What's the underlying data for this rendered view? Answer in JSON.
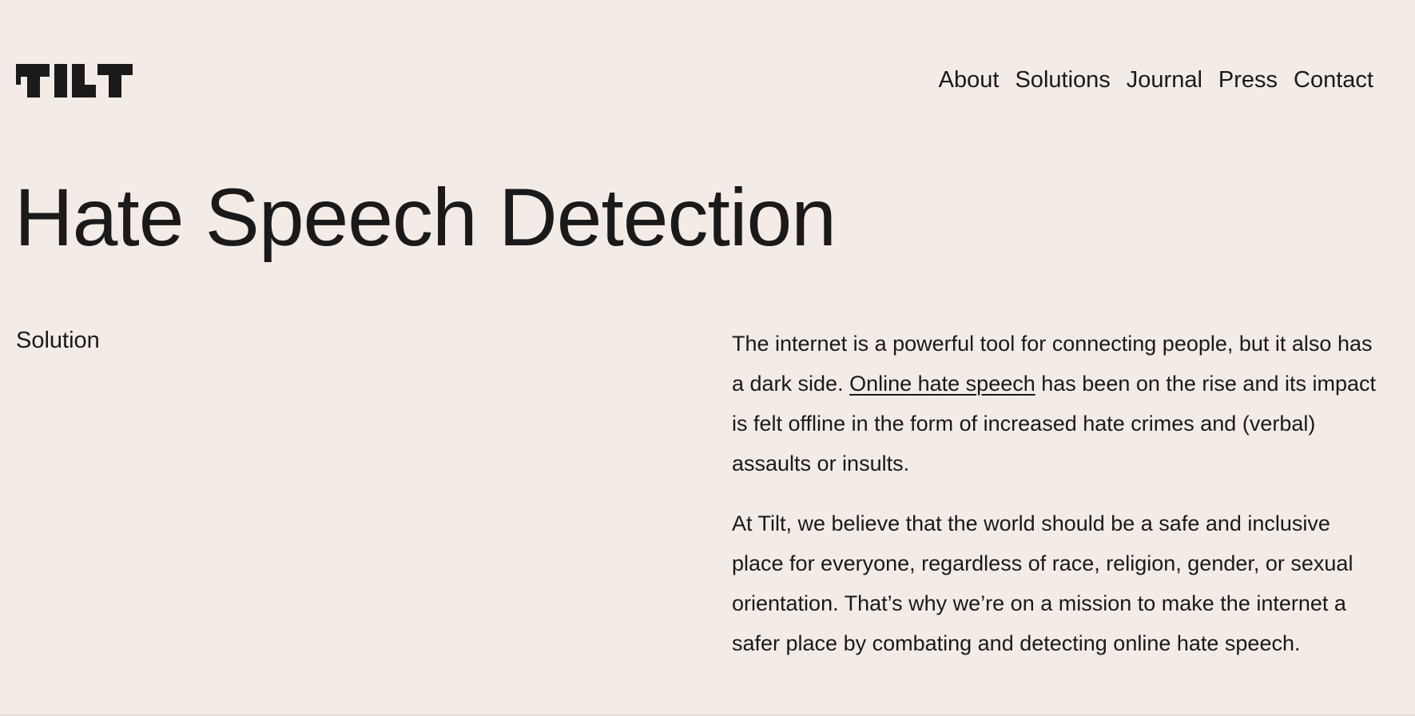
{
  "brand": {
    "logo_text": "TILT",
    "icon": "tilt-wordmark-logo"
  },
  "nav": {
    "items": [
      {
        "label": "About"
      },
      {
        "label": "Solutions"
      },
      {
        "label": "Journal"
      },
      {
        "label": "Press"
      },
      {
        "label": "Contact"
      }
    ]
  },
  "hero": {
    "title": "Hate Speech Detection"
  },
  "section": {
    "label": "Solution"
  },
  "content": {
    "p1_before_link": "The internet is a powerful tool for connecting people, but it also has a dark side. ",
    "p1_link": "Online hate speech",
    "p1_after_link": " has been on the rise and its impact is felt offline in the form of increased hate crimes and (verbal) assaults or insults.",
    "p2": "At Tilt, we believe that the world should be a safe and inclusive place for everyone, regardless of race, religion, gender, or sexual orientation. That’s why we’re on a mission to make the internet a safer place by combating and detecting online hate speech."
  },
  "colors": {
    "background": "#f3ebe6",
    "text": "#1a1a1a"
  }
}
